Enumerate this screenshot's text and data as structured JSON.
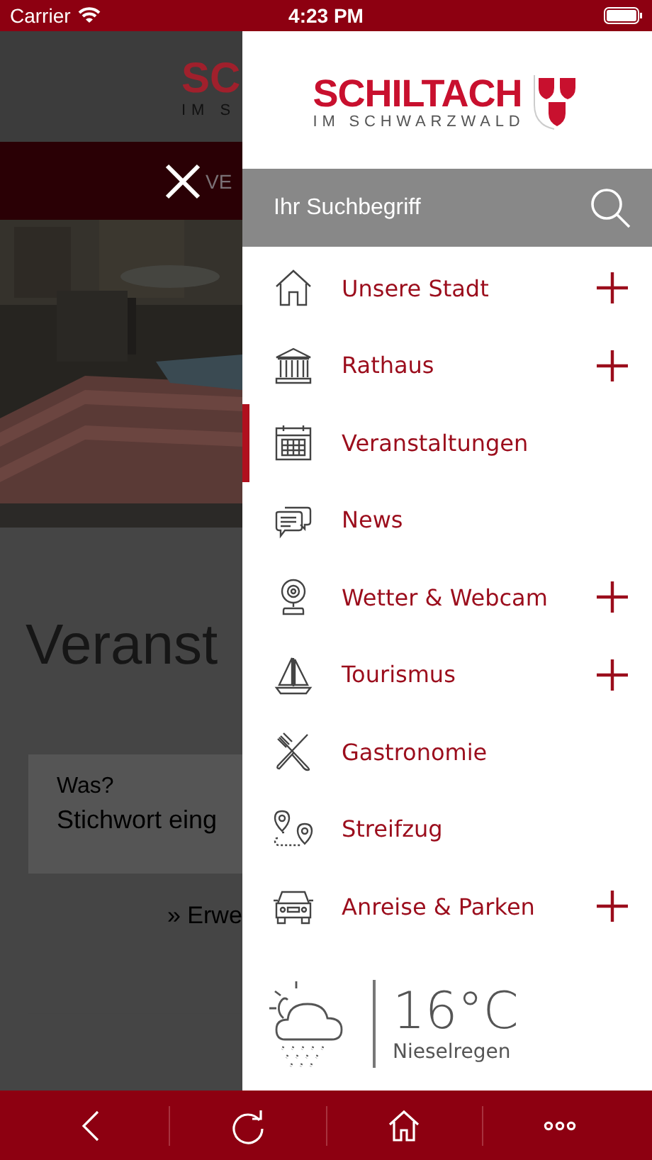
{
  "status_bar": {
    "carrier": "Carrier",
    "time": "4:23 PM"
  },
  "background_page": {
    "logo": "SC",
    "logo_subtitle": "IM S",
    "section_bar": "VE",
    "title": "Veranst",
    "filter_label": "Was?",
    "filter_placeholder": "Stichwort eing",
    "more_link": "» Erwe"
  },
  "drawer": {
    "logo": {
      "name": "SCHILTACH",
      "subtitle": "IM SCHWARZWALD"
    },
    "search": {
      "placeholder": "Ihr Suchbegriff"
    },
    "menu": [
      {
        "label": "Unsere Stadt",
        "kind": "home",
        "expandable": true,
        "selected": false
      },
      {
        "label": "Rathaus",
        "kind": "building",
        "expandable": true,
        "selected": false
      },
      {
        "label": "Veranstaltungen",
        "kind": "calendar",
        "expandable": false,
        "selected": true
      },
      {
        "label": "News",
        "kind": "chat",
        "expandable": false,
        "selected": false
      },
      {
        "label": "Wetter & Webcam",
        "kind": "webcam",
        "expandable": true,
        "selected": false
      },
      {
        "label": "Tourismus",
        "kind": "boat",
        "expandable": true,
        "selected": false
      },
      {
        "label": "Gastronomie",
        "kind": "cutlery",
        "expandable": false,
        "selected": false
      },
      {
        "label": "Streifzug",
        "kind": "route",
        "expandable": false,
        "selected": false
      },
      {
        "label": "Anreise & Parken",
        "kind": "car",
        "expandable": true,
        "selected": false
      }
    ],
    "weather": {
      "temperature": "16°C",
      "description": "Nieselregen"
    }
  },
  "toolbar": [
    {
      "kind": "back"
    },
    {
      "kind": "refresh"
    },
    {
      "kind": "home"
    },
    {
      "kind": "more"
    }
  ]
}
